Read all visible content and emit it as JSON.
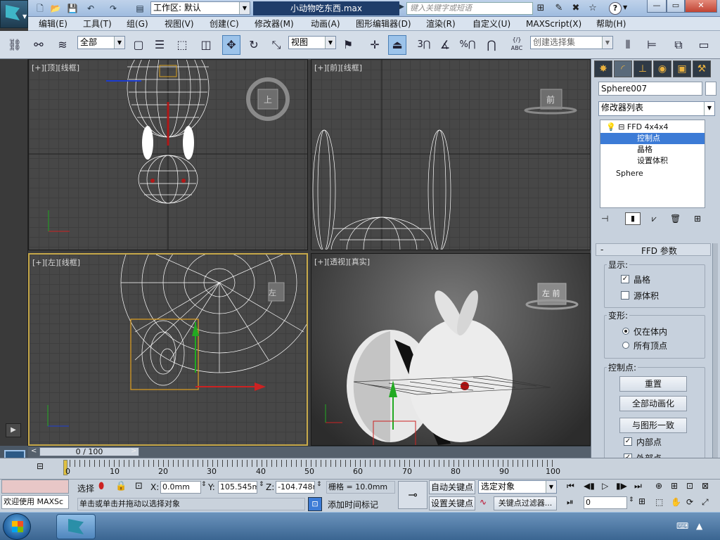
{
  "titlebar": {
    "workspace_label": "工作区: 默认",
    "doc_title": "小动物吃东西.max",
    "search_placeholder": "键入关键字或短语",
    "help_label": "?",
    "min_label": "—",
    "max_label": "▭",
    "close_label": "✕"
  },
  "menu": [
    "编辑(E)",
    "工具(T)",
    "组(G)",
    "视图(V)",
    "创建(C)",
    "修改器(M)",
    "动画(A)",
    "图形编辑器(D)",
    "渲染(R)",
    "自定义(U)",
    "MAXScript(X)",
    "帮助(H)"
  ],
  "toolbar": {
    "selection_filter": "全部",
    "ref_coord": "视图",
    "named_selection": "创建选择集",
    "snap_3": "3",
    "snap_percent": "%",
    "abc_label": "ABC"
  },
  "viewports": {
    "top": {
      "plus": "[+]",
      "view": "[顶]",
      "shading": "[线框]",
      "cube_label": "上"
    },
    "front": {
      "plus": "[+]",
      "view": "[前]",
      "shading": "[线框]",
      "cube_label": "前"
    },
    "left": {
      "plus": "[+]",
      "view": "[左]",
      "shading": "[线框]",
      "cube_label": "左"
    },
    "persp": {
      "plus": "[+]",
      "view": "[透视]",
      "shading": "[真实]",
      "cube_label": "左 前"
    }
  },
  "command_panel": {
    "object_name": "Sphere007",
    "modifier_list": "修改器列表",
    "stack": [
      {
        "label": "FFD 4x4x4",
        "level": 0
      },
      {
        "label": "控制点",
        "level": 1,
        "selected": true
      },
      {
        "label": "晶格",
        "level": 1
      },
      {
        "label": "设置体积",
        "level": 1
      },
      {
        "label": "Sphere",
        "level": 0
      }
    ],
    "rollout_title": "FFD 参数",
    "display": {
      "label": "显示:",
      "lattice": "晶格",
      "lattice_checked": true,
      "source_volume": "源体积",
      "source_volume_checked": false
    },
    "deform": {
      "label": "变形:",
      "only_in_volume": "仅在体内",
      "all_vertices": "所有顶点",
      "selected": "only_in_volume"
    },
    "control_points": {
      "label": "控制点:",
      "reset": "重置",
      "animate_all": "全部动画化",
      "conform": "与图形一致",
      "inside_points": "内部点",
      "inside_checked": true,
      "outside_points": "外部点",
      "outside_checked": true
    }
  },
  "timeline": {
    "slider_label": "0 / 100",
    "ticks": [
      "0",
      "10",
      "20",
      "30",
      "40",
      "50",
      "60",
      "70",
      "80",
      "90",
      "100"
    ]
  },
  "status": {
    "welcome": "欢迎使用 MAXSc",
    "select_label": "选择",
    "x_label": "X:",
    "x_value": "0.0mm",
    "y_label": "Y:",
    "y_value": "105.545mm",
    "z_label": "Z:",
    "z_value": "-104.748m",
    "grid_label": "栅格 = 10.0mm",
    "prompt": "单击或单击并拖动以选择对象",
    "add_time_tag": "添加时间标记",
    "auto_key": "自动关键点",
    "set_key": "设置关键点",
    "key_target": "选定对象",
    "key_filters": "关键点过滤器...",
    "frame_value": "0"
  },
  "colors": {
    "auto_key_bg": "#e8c7c7",
    "selection_blue": "#3c7bd6",
    "viewport_bg": "#474747",
    "active_border": "#c7a94a"
  }
}
